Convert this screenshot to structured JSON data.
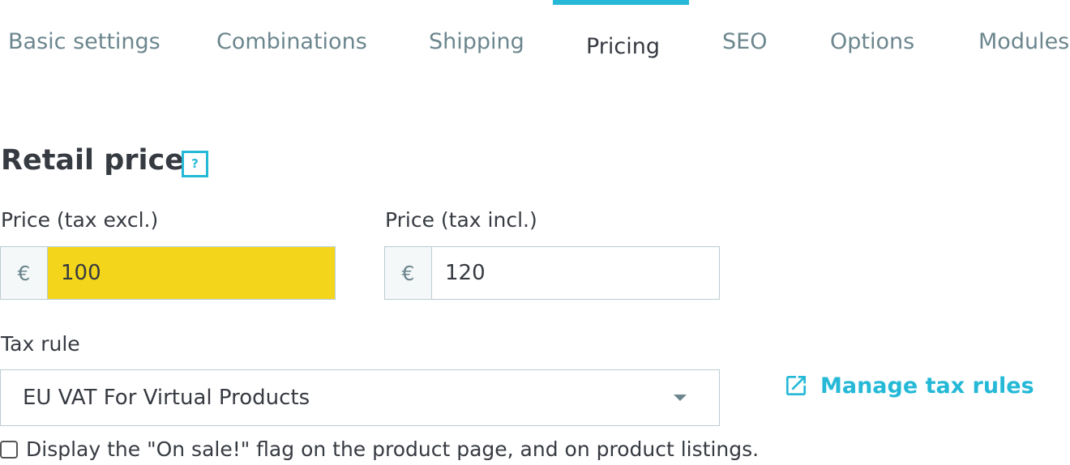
{
  "tabs": [
    {
      "label": "Basic settings",
      "active": false
    },
    {
      "label": "Combinations",
      "active": false
    },
    {
      "label": "Shipping",
      "active": false
    },
    {
      "label": "Pricing",
      "active": true
    },
    {
      "label": "SEO",
      "active": false
    },
    {
      "label": "Options",
      "active": false
    },
    {
      "label": "Modules",
      "active": false
    }
  ],
  "retail_price": {
    "title": "Retail price",
    "help_icon": "?",
    "price_excl": {
      "label": "Price (tax excl.)",
      "currency": "€",
      "value": "100"
    },
    "price_incl": {
      "label": "Price (tax incl.)",
      "currency": "€",
      "value": "120"
    }
  },
  "tax_rule": {
    "label": "Tax rule",
    "selected": "EU VAT For Virtual Products",
    "manage_link": "Manage tax rules",
    "manage_icon": "external-link-icon"
  },
  "on_sale": {
    "label": "Display the \"On sale!\" flag on the product page, and on product listings.",
    "checked": false
  },
  "colors": {
    "accent": "#25b9d7",
    "highlight": "#f3d51b",
    "text": "#363a41",
    "muted": "#6c868e",
    "border": "#bbcdd2"
  }
}
